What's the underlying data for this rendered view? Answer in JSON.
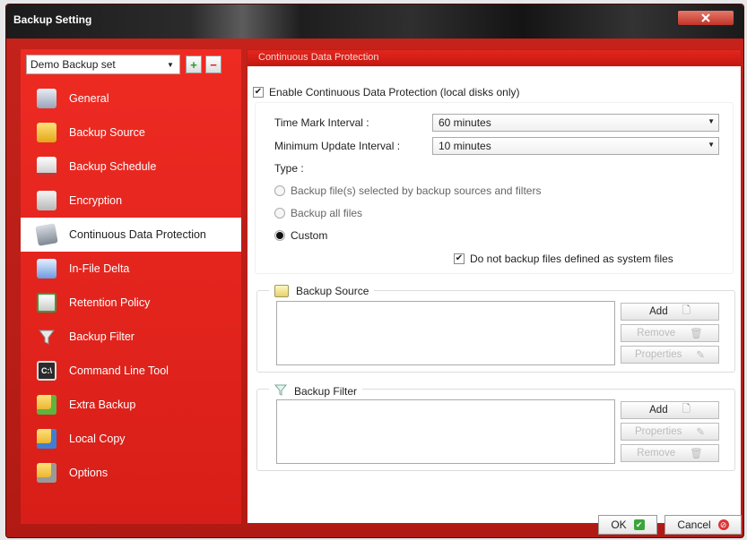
{
  "window": {
    "title": "Backup Setting"
  },
  "sidebar": {
    "backup_set": "Demo Backup set",
    "add_symbol": "+",
    "remove_symbol": "−",
    "items": [
      {
        "label": "General"
      },
      {
        "label": "Backup Source"
      },
      {
        "label": "Backup Schedule"
      },
      {
        "label": "Encryption"
      },
      {
        "label": "Continuous Data Protection"
      },
      {
        "label": "In-File Delta"
      },
      {
        "label": "Retention Policy"
      },
      {
        "label": "Backup Filter"
      },
      {
        "label": "Command Line Tool"
      },
      {
        "label": "Extra Backup"
      },
      {
        "label": "Local Copy"
      },
      {
        "label": "Options"
      }
    ]
  },
  "main": {
    "header": "Continuous Data Protection",
    "enable_label": "Enable Continuous Data Protection (local disks only)",
    "time_mark_label": "Time Mark Interval :",
    "time_mark_value": "60 minutes",
    "min_update_label": "Minimum Update Interval :",
    "min_update_value": "10 minutes",
    "type_label": "Type :",
    "radio_selected_sources": "Backup file(s) selected by backup sources and filters",
    "radio_all_files": "Backup all files",
    "radio_custom": "Custom",
    "system_files_label": "Do not backup files defined as system files",
    "backup_source": {
      "title": "Backup Source",
      "add": "Add",
      "remove": "Remove",
      "properties": "Properties"
    },
    "backup_filter": {
      "title": "Backup Filter",
      "add": "Add",
      "properties": "Properties",
      "remove": "Remove"
    }
  },
  "footer": {
    "ok": "OK",
    "cancel": "Cancel"
  }
}
